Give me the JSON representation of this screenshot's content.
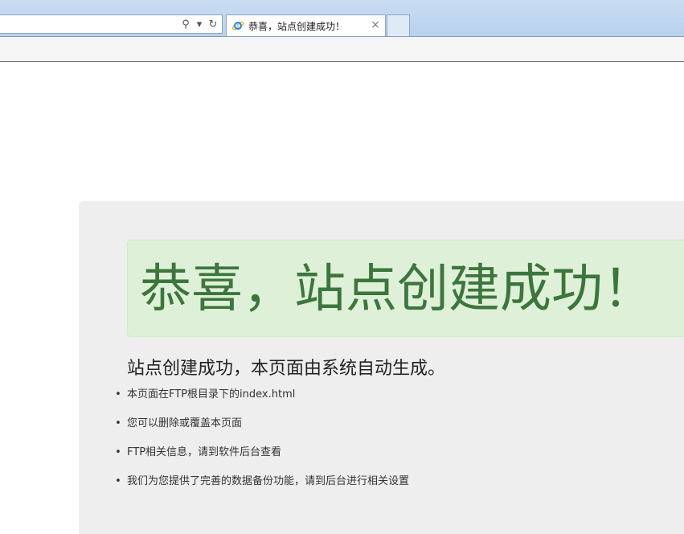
{
  "browser": {
    "tab": {
      "title": "恭喜，站点创建成功！",
      "close_glyph": "×",
      "icon": "ie-icon"
    },
    "address_bar": {
      "icons": [
        "search-icon",
        "dropdown-icon",
        "refresh-icon"
      ],
      "glyphs": {
        "search": "⚲",
        "dropdown": "▾",
        "refresh": "↻"
      }
    }
  },
  "page": {
    "success_title": "恭喜，站点创建成功！",
    "subtitle": "站点创建成功，本页面由系统自动生成。",
    "bullet_glyph": "•",
    "items": [
      "本页面在FTP根目录下的index.html",
      "您可以删除或覆盖本页面",
      "FTP相关信息，请到软件后台查看",
      "我们为您提供了完善的数据备份功能，请到后台进行相关设置"
    ]
  },
  "colors": {
    "success_text": "#3c763d",
    "success_bg": "#dff0d8",
    "panel_bg": "#eeeeee",
    "chrome_bg": "#b9d1ee"
  }
}
